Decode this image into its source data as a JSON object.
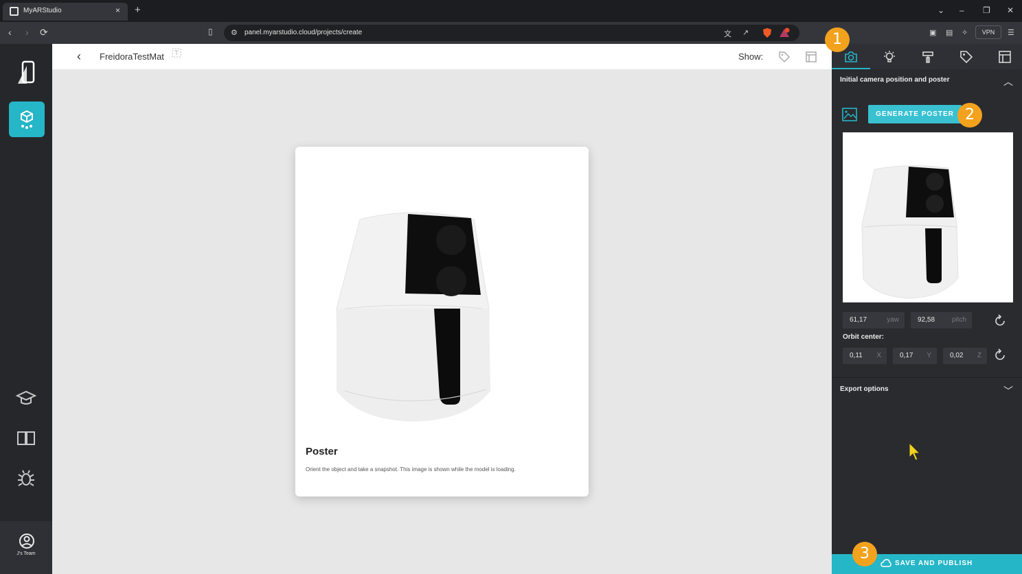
{
  "browser": {
    "tab_title": "MyARStudio",
    "tab_close": "×",
    "new_tab": "+",
    "url": "panel.myarstudio.cloud/projects/create",
    "vpn_label": "VPN",
    "window_controls": [
      "⌄",
      "–",
      "❐",
      "✕"
    ]
  },
  "sidebar": {
    "team_label": "J's Team",
    "icons": [
      "cube-icon",
      "graduation-cap-icon",
      "book-icon",
      "bug-icon",
      "user-circle-icon"
    ]
  },
  "header": {
    "back": "‹",
    "project_title": "FreidoraTestMat",
    "show_label": "Show:"
  },
  "card": {
    "title": "Poster",
    "description": "Orient the object and take a snapshot. This image is shown while the model is loading."
  },
  "panel": {
    "tabs": [
      "camera-icon",
      "light-bulb-icon",
      "paint-roller-icon",
      "tag-icon",
      "layout-icon"
    ],
    "section1_title": "Initial camera position and poster",
    "generate_label": "GENERATE POSTER",
    "yaw": {
      "value": "61,17",
      "unit": "yaw"
    },
    "pitch": {
      "value": "92,58",
      "unit": "pitch"
    },
    "orbit_label": "Orbit center:",
    "orbit": [
      {
        "value": "0,11",
        "unit": "X"
      },
      {
        "value": "0,17",
        "unit": "Y"
      },
      {
        "value": "0,02",
        "unit": "Z"
      }
    ],
    "section2_title": "Export options",
    "save_label": "SAVE AND PUBLISH"
  },
  "badges": [
    "1",
    "2",
    "3"
  ],
  "colors": {
    "accent": "#25b6c7",
    "badge": "#f3a21d"
  }
}
